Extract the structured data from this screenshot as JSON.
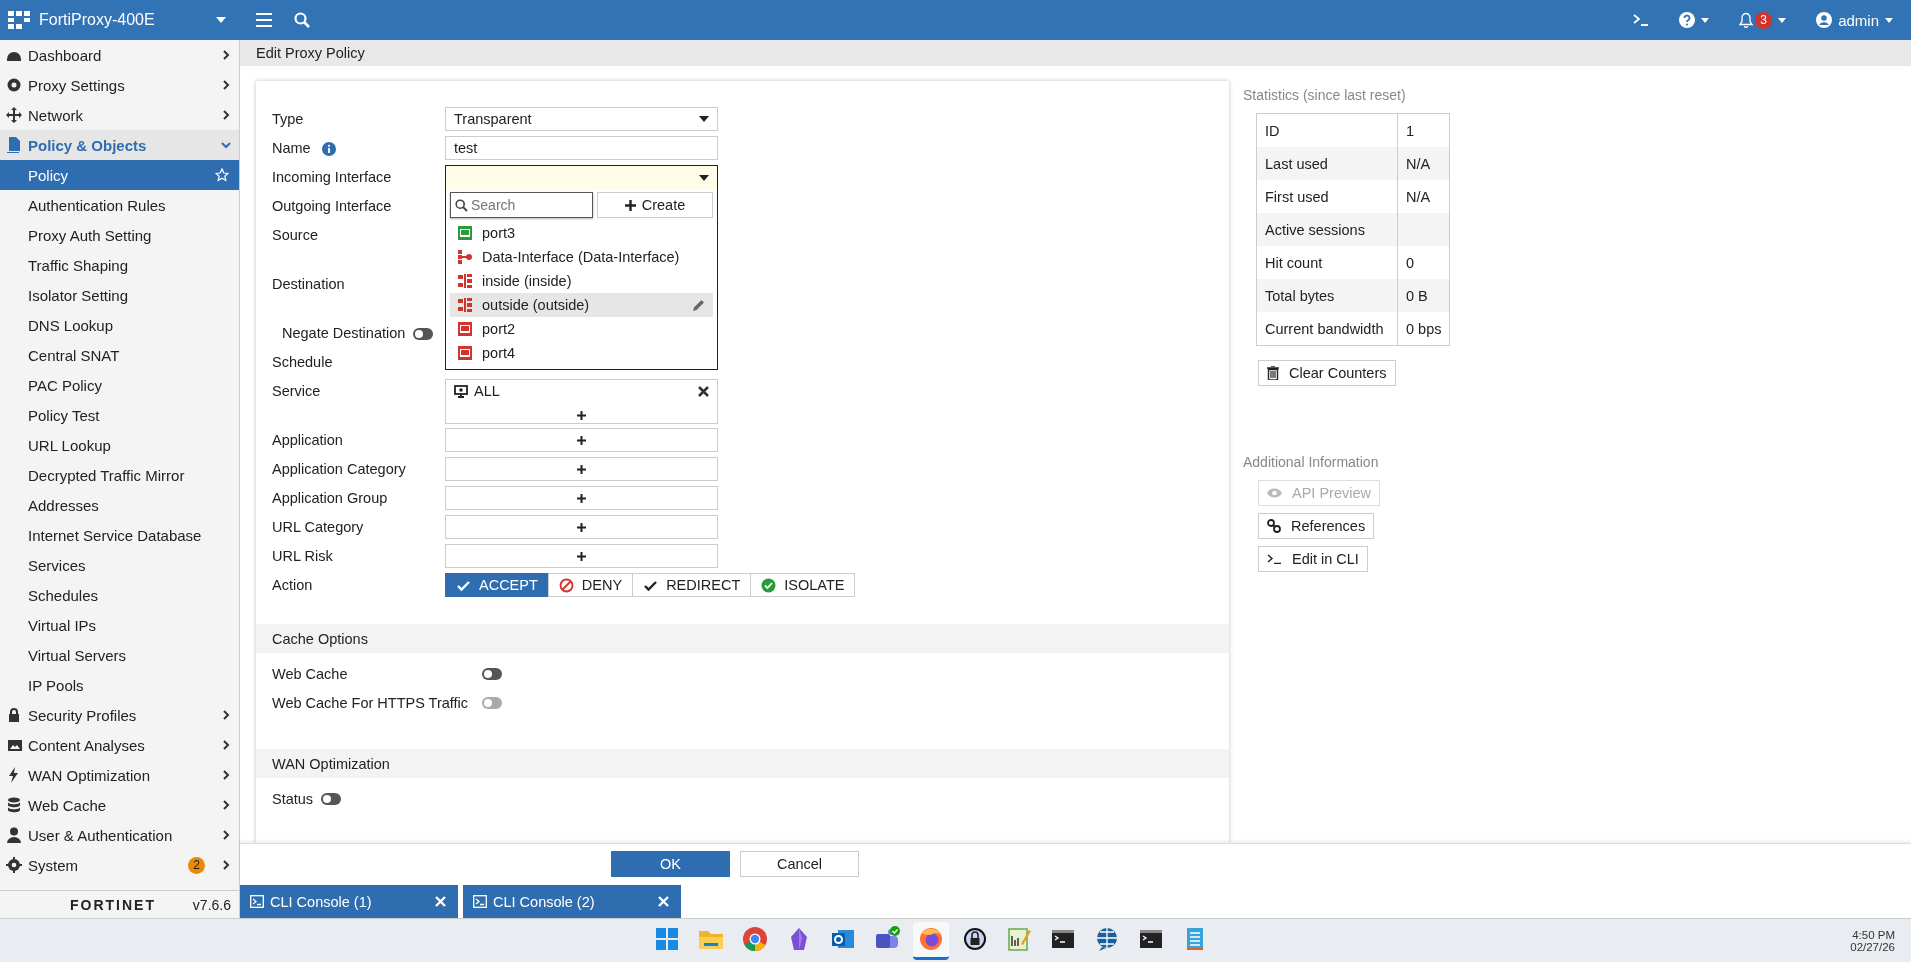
{
  "topbar": {
    "device": "FortiProxy-400E",
    "notifications": "3",
    "user": "admin"
  },
  "sidebar": {
    "items": [
      {
        "label": "Dashboard",
        "kind": "dashboard",
        "expanded": false
      },
      {
        "label": "Proxy Settings",
        "kind": "cog",
        "expanded": false
      },
      {
        "label": "Network",
        "kind": "arrows",
        "expanded": false
      },
      {
        "label": "Policy & Objects",
        "kind": "document",
        "expanded": true,
        "children": [
          {
            "label": "Policy",
            "selected": true
          },
          {
            "label": "Authentication Rules",
            "selected": false
          },
          {
            "label": "Proxy Auth Setting",
            "selected": false
          },
          {
            "label": "Traffic Shaping",
            "selected": false
          },
          {
            "label": "Isolator Setting",
            "selected": false
          },
          {
            "label": "DNS Lookup",
            "selected": false
          },
          {
            "label": "Central SNAT",
            "selected": false
          },
          {
            "label": "PAC Policy",
            "selected": false
          },
          {
            "label": "Policy Test",
            "selected": false
          },
          {
            "label": "URL Lookup",
            "selected": false
          },
          {
            "label": "Decrypted Traffic Mirror",
            "selected": false
          },
          {
            "label": "Addresses",
            "selected": false
          },
          {
            "label": "Internet Service Database",
            "selected": false
          },
          {
            "label": "Services",
            "selected": false
          },
          {
            "label": "Schedules",
            "selected": false
          },
          {
            "label": "Virtual IPs",
            "selected": false
          },
          {
            "label": "Virtual Servers",
            "selected": false
          },
          {
            "label": "IP Pools",
            "selected": false
          }
        ]
      },
      {
        "label": "Security Profiles",
        "kind": "lock",
        "expanded": false
      },
      {
        "label": "Content Analyses",
        "kind": "image",
        "expanded": false
      },
      {
        "label": "WAN Optimization",
        "kind": "bolt",
        "expanded": false
      },
      {
        "label": "Web Cache",
        "kind": "database",
        "expanded": false
      },
      {
        "label": "User & Authentication",
        "kind": "user",
        "expanded": false
      },
      {
        "label": "System",
        "kind": "gear",
        "expanded": false,
        "badge": "2"
      }
    ],
    "brand": "FORTINET",
    "version": "v7.6.6"
  },
  "page": {
    "title": "Edit Proxy Policy"
  },
  "form": {
    "rows": [
      {
        "label": "Type",
        "kind": "select",
        "value": "Transparent"
      },
      {
        "label": "Name",
        "kind": "text",
        "value": "test",
        "info": true
      },
      {
        "label": "Incoming Interface",
        "kind": "interface"
      },
      {
        "label": "Outgoing Interface",
        "kind": "covered"
      },
      {
        "label": "Source",
        "kind": "covered-list"
      },
      {
        "label": "Destination",
        "kind": "covered-list"
      },
      {
        "label": "Negate Destination",
        "kind": "toggle",
        "on": false
      },
      {
        "label": "Schedule",
        "kind": "covered"
      },
      {
        "label": "Service",
        "kind": "service",
        "items": [
          {
            "label": "ALL"
          }
        ]
      },
      {
        "label": "Application",
        "kind": "add"
      },
      {
        "label": "Application Category",
        "kind": "add"
      },
      {
        "label": "Application Group",
        "kind": "add"
      },
      {
        "label": "URL Category",
        "kind": "add"
      },
      {
        "label": "URL Risk",
        "kind": "add"
      },
      {
        "label": "Action",
        "kind": "action",
        "options": [
          {
            "label": "ACCEPT",
            "kind": "accept",
            "selected": true
          },
          {
            "label": "DENY",
            "kind": "deny",
            "selected": false
          },
          {
            "label": "REDIRECT",
            "kind": "redirect",
            "selected": false
          },
          {
            "label": "ISOLATE",
            "kind": "isolate",
            "selected": false
          }
        ]
      }
    ],
    "dropdown": {
      "placeholder": "Search",
      "create": "Create",
      "items": [
        {
          "label": "port3",
          "kind": "port",
          "color": "#2a9a3a",
          "selected": false
        },
        {
          "label": "Data-Interface (Data-Interface)",
          "kind": "aggregate",
          "color": "#d0342c",
          "selected": false
        },
        {
          "label": "inside (inside)",
          "kind": "zone",
          "color": "#d0342c",
          "selected": false
        },
        {
          "label": "outside (outside)",
          "kind": "zone",
          "color": "#d0342c",
          "selected": true
        },
        {
          "label": "port2",
          "kind": "port",
          "color": "#d0342c",
          "selected": false
        },
        {
          "label": "port4",
          "kind": "port",
          "color": "#d0342c",
          "selected": false
        }
      ]
    },
    "sections": [
      {
        "title": "Cache Options",
        "rows": [
          {
            "label": "Web Cache",
            "kind": "column",
            "on": false,
            "disabled": false
          },
          {
            "label": "Web Cache For HTTPS Traffic",
            "kind": "column",
            "on": false,
            "disabled": true
          }
        ]
      },
      {
        "title": "WAN Optimization",
        "rows": [
          {
            "label": "Status",
            "kind": "inline",
            "on": false,
            "disabled": false
          }
        ]
      }
    ]
  },
  "statistics": {
    "title": "Statistics (since last reset)",
    "rows": [
      {
        "label": "ID",
        "value": "1"
      },
      {
        "label": "Last used",
        "value": "N/A"
      },
      {
        "label": "First used",
        "value": "N/A"
      },
      {
        "label": "Active sessions"
      },
      {
        "label": "Hit count",
        "value": "0"
      },
      {
        "label": "Total bytes",
        "value": "0 B"
      },
      {
        "label": "Current bandwidth",
        "value": "0 bps"
      }
    ],
    "clear": "Clear Counters"
  },
  "additional": {
    "title": "Additional Information",
    "buttons": [
      {
        "label": "API Preview",
        "kind": "eye",
        "disabled": true
      },
      {
        "label": "References",
        "kind": "link",
        "disabled": false
      },
      {
        "label": "Edit in CLI",
        "kind": "cli",
        "disabled": false
      }
    ]
  },
  "footer": {
    "ok": "OK",
    "cancel": "Cancel"
  },
  "consoles": [
    {
      "label": "CLI Console (1)"
    },
    {
      "label": "CLI Console (2)"
    }
  ],
  "taskbar": {
    "apps": [
      {
        "kind": "start",
        "selected": false
      },
      {
        "kind": "folder",
        "selected": false
      },
      {
        "kind": "chrome",
        "selected": false
      },
      {
        "kind": "crystal",
        "selected": false
      },
      {
        "kind": "mail",
        "selected": false
      },
      {
        "kind": "teams",
        "selected": false
      },
      {
        "kind": "firefox",
        "selected": true
      },
      {
        "kind": "lock",
        "selected": false
      },
      {
        "kind": "notepad",
        "selected": false
      },
      {
        "kind": "terminal",
        "selected": false
      },
      {
        "kind": "globe",
        "selected": false
      },
      {
        "kind": "terminal",
        "selected": false
      },
      {
        "kind": "notes",
        "selected": false
      }
    ],
    "time": "4:50 PM",
    "date": "02/27/26"
  }
}
